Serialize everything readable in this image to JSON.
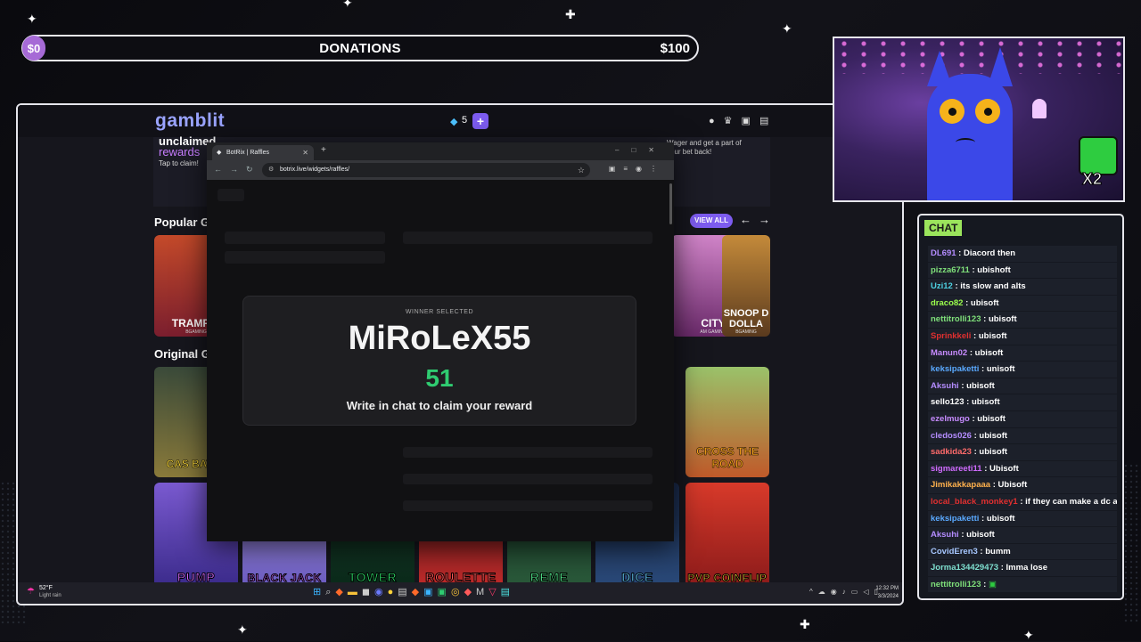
{
  "donations": {
    "min": "$0",
    "title": "DONATIONS",
    "max": "$100",
    "progress": 0
  },
  "site": {
    "logo": "gamblit",
    "gems": "5",
    "plus": "+",
    "promo": {
      "line1": "unclaimed",
      "line2": "rewards",
      "line3": "Tap to claim!",
      "right_text": "Wager and get a part of your bet back!"
    },
    "popular_title": "Popular G",
    "original_title": "Original G",
    "view_all": "VIEW ALL",
    "popular_cards": [
      {
        "title": "TRAMP D",
        "sub": "BGAMING"
      },
      {
        "title": "CITY",
        "sub": "AM GAMING"
      },
      {
        "title": "SNOOP D DOLLA",
        "sub": "BGAMING"
      }
    ],
    "original_cards": [
      {
        "title": "CAS BATTL"
      },
      {
        "title": "CROSS THE ROAD"
      }
    ],
    "bottom_cards": [
      "PUMP",
      "BLACK JACK",
      "TOWER",
      "ROULETTE",
      "REME",
      "DICE",
      "PVP COINFLIP"
    ]
  },
  "browser": {
    "tab_title": "BotRix | Raffles",
    "url": "botrix.live/widgets/raffles/"
  },
  "raffle": {
    "label": "WINNER SELECTED",
    "winner": "MiRoLeX55",
    "number": "51",
    "message": "Write in chat to claim your reward"
  },
  "taskbar": {
    "temp": "52°F",
    "weather": "Light rain",
    "time": "12:32 PM",
    "date": "3/3/2024"
  },
  "cam": {
    "badge": "X2"
  },
  "chat": {
    "title": "CHAT",
    "messages": [
      {
        "user": "DL691",
        "color": "#b48cff",
        "text": "Diacord then"
      },
      {
        "user": "pizza6711",
        "color": "#7fe07a",
        "text": "ubishoft"
      },
      {
        "user": "Uzi12",
        "color": "#4dd0e1",
        "text": "its slow and alts"
      },
      {
        "user": "draco82",
        "color": "#9bff4d",
        "text": "ubisoft"
      },
      {
        "user": "nettitrolli123",
        "color": "#7fe07a",
        "text": "ubisoft"
      },
      {
        "user": "Sprinkkeli",
        "color": "#e03030",
        "text": "ubisoft"
      },
      {
        "user": "Manun02",
        "color": "#c78bff",
        "text": "ubisoft"
      },
      {
        "user": "keksipaketti",
        "color": "#5aa9ff",
        "text": "unisoft"
      },
      {
        "user": "Aksuhi",
        "color": "#b48cff",
        "text": "ubisoft"
      },
      {
        "user": "sello123",
        "color": "#ffffff",
        "text": "ubisoft"
      },
      {
        "user": "ezelmugo",
        "color": "#c78bff",
        "text": "ubisoft"
      },
      {
        "user": "cledos026",
        "color": "#b48cff",
        "text": "ubisoft"
      },
      {
        "user": "sadkida23",
        "color": "#ff6b6b",
        "text": "ubisoft"
      },
      {
        "user": "sigmareeti11",
        "color": "#d06bff",
        "text": "Ubisoft"
      },
      {
        "user": "Jimikakkapaaa",
        "color": "#ffb14d",
        "text": "Ubisoft"
      },
      {
        "user": "local_black_monkey1",
        "color": "#e03030",
        "text": "if they can make a dc acc"
      },
      {
        "user": "keksipaketti",
        "color": "#5aa9ff",
        "text": "ubisoft"
      },
      {
        "user": "Aksuhi",
        "color": "#b48cff",
        "text": "ubisoft"
      },
      {
        "user": "CovidEren3",
        "color": "#a7c7ff",
        "text": "bumm"
      },
      {
        "user": "Jorma134429473",
        "color": "#7fe0d0",
        "text": "Imma lose"
      },
      {
        "user": "nettitrolli123",
        "color": "#7fe07a",
        "text": ""
      }
    ]
  }
}
